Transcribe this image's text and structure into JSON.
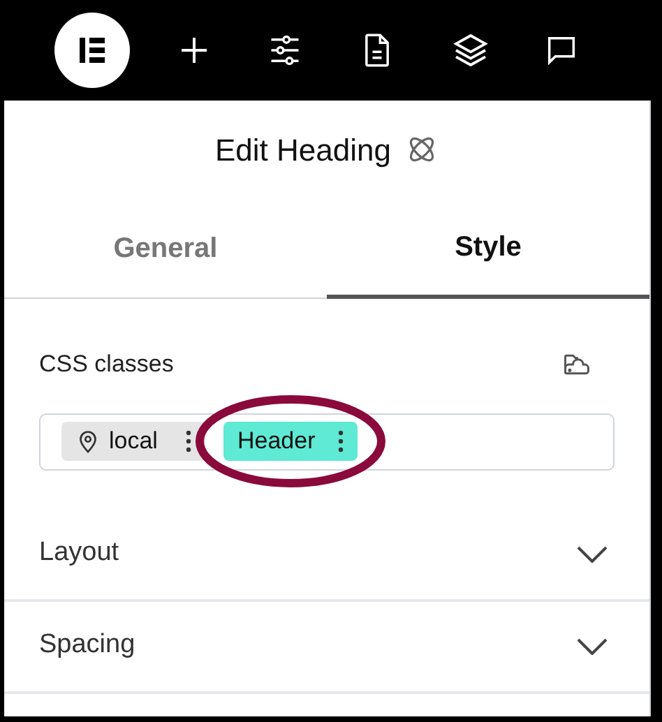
{
  "panel": {
    "title": "Edit Heading"
  },
  "tabs": [
    {
      "label": "General",
      "selected": false
    },
    {
      "label": "Style",
      "selected": true
    }
  ],
  "css_classes": {
    "label": "CSS classes",
    "chips": [
      {
        "label": "local",
        "kind": "local",
        "color": "#e5e5e5",
        "highlighted": false
      },
      {
        "label": "Header",
        "kind": "class",
        "color": "#5eead4",
        "highlighted": true
      }
    ]
  },
  "sections": [
    {
      "label": "Layout",
      "expanded": false
    },
    {
      "label": "Spacing",
      "expanded": false
    }
  ]
}
